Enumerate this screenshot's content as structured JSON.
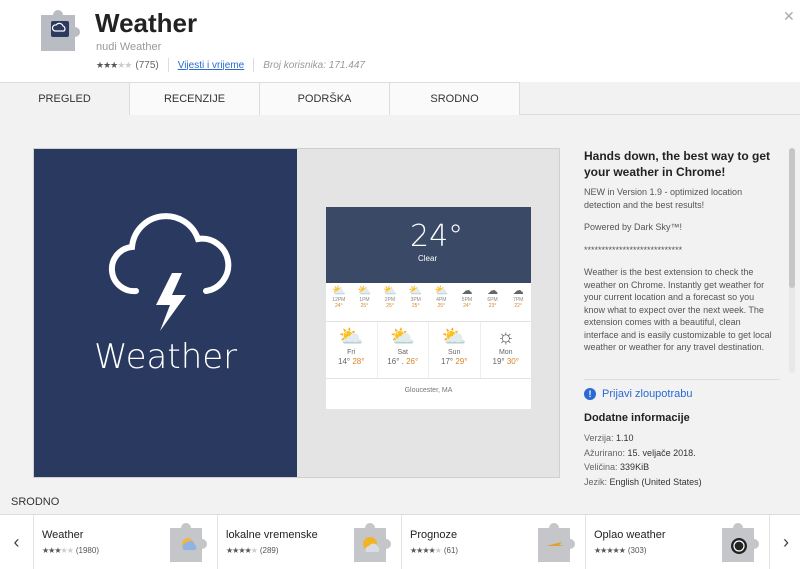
{
  "header": {
    "title": "Weather",
    "subtitle": "nudi Weather",
    "rating_count": "(775)",
    "category_link": "Vijesti i vrijeme",
    "users": "Broj korisnika: 171.447"
  },
  "tabs": [
    {
      "label": "PREGLED"
    },
    {
      "label": "RECENZIJE"
    },
    {
      "label": "PODRŠKA"
    },
    {
      "label": "SRODNO"
    }
  ],
  "screenshot": {
    "logo_word": "Weather",
    "temp": "24°",
    "condition": "Clear",
    "hours": [
      {
        "time": "12PM",
        "a": "24°",
        "b": "24°"
      },
      {
        "time": "1PM",
        "a": "25°",
        "b": "25°"
      },
      {
        "time": "2PM",
        "a": "25°",
        "b": "26°"
      },
      {
        "time": "3PM",
        "a": "25°",
        "b": "26°"
      },
      {
        "time": "4PM",
        "a": "25°",
        "b": "25°"
      },
      {
        "time": "5PM",
        "a": "24°",
        "b": "24°"
      },
      {
        "time": "6PM",
        "a": "23°",
        "b": "23°"
      },
      {
        "time": "7PM",
        "a": "22°",
        "b": "22°"
      }
    ],
    "days": [
      {
        "name": "Fri",
        "low": "14°",
        "high": "28°"
      },
      {
        "name": "Sat",
        "low": "16°",
        "high": "26°"
      },
      {
        "name": "Sun",
        "low": "17°",
        "high": "29°"
      },
      {
        "name": "Mon",
        "low": "19°",
        "high": "30°"
      }
    ],
    "location": "Gloucester, MA"
  },
  "description": {
    "headline": "Hands down, the best way to get your weather in Chrome!",
    "p1": "NEW in Version 1.9 - optimized location detection and the best results!",
    "p2": "Powered by Dark Sky™!",
    "p3": "****************************",
    "p4": "Weather is the best extension to check the weather on Chrome. Instantly get weather for your current location and a forecast so you know what to expect over the next week. The extension comes with a beautiful, clean interface and is easily customizable to get local weather or weather for any travel destination."
  },
  "report_link": "Prijavi zloupotrabu",
  "additional": {
    "title": "Dodatne informacije",
    "version_label": "Verzija:",
    "version": "1.10",
    "updated_label": "Ažurirano:",
    "updated": "15. veljače 2018.",
    "size_label": "Veličina:",
    "size": "339KiB",
    "language_label": "Jezik:",
    "language": "English (United States)"
  },
  "related": {
    "title": "SRODNO",
    "items": [
      {
        "name": "Weather",
        "count": "(1980)",
        "stars": 3
      },
      {
        "name": "lokalne vremenske",
        "count": "(289)",
        "stars": 4
      },
      {
        "name": "Prognoze",
        "count": "(61)",
        "stars": 4
      },
      {
        "name": "Oplao weather",
        "count": "(303)",
        "stars": 5
      }
    ]
  },
  "colors": {
    "accent": "#2a6ad3",
    "tile_bg": "#29395f"
  }
}
